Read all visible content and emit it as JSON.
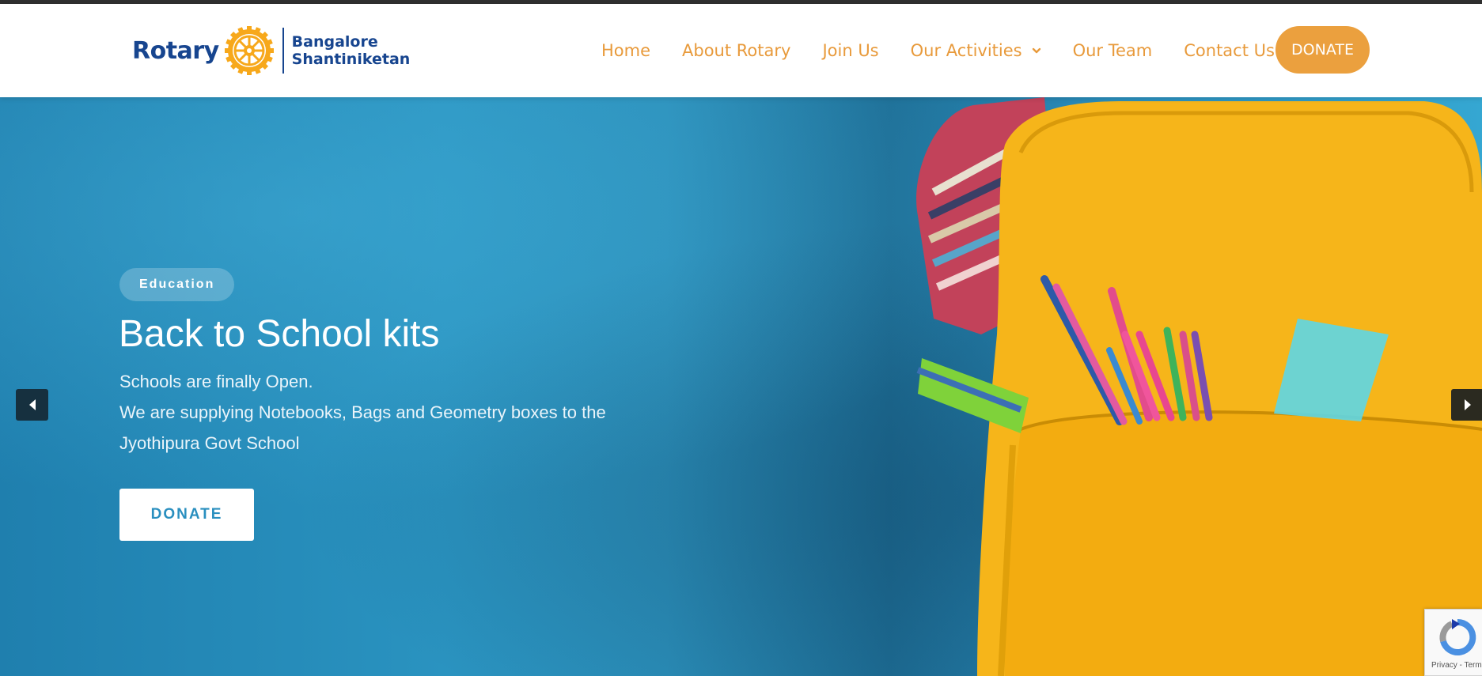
{
  "header": {
    "logo": {
      "wordmark": "Rotary",
      "club_line1": "Bangalore",
      "club_line2": "Shantiniketan"
    },
    "nav": [
      {
        "label": "Home"
      },
      {
        "label": "About Rotary"
      },
      {
        "label": "Join Us"
      },
      {
        "label": "Our Activities",
        "has_dropdown": true,
        "icon": "chevron-down-icon"
      },
      {
        "label": "Our Team"
      },
      {
        "label": "Contact Us"
      }
    ],
    "donate_label": "DONATE"
  },
  "hero": {
    "badge": "Education",
    "title": "Back to School kits",
    "lines": [
      "Schools are finally Open.",
      "We are supplying Notebooks, Bags and Geometry boxes to the",
      "Jyothipura Govt School"
    ],
    "donate_label": "DONATE",
    "prev_icon": "caret-left-icon",
    "next_icon": "caret-right-icon"
  },
  "recaptcha": {
    "text": "Privacy - Terms"
  },
  "colors": {
    "nav_text": "#e89a3b",
    "donate_bg": "#eba03e",
    "rotary_blue": "#17458f",
    "hero_blue": "#2a8fbf"
  }
}
